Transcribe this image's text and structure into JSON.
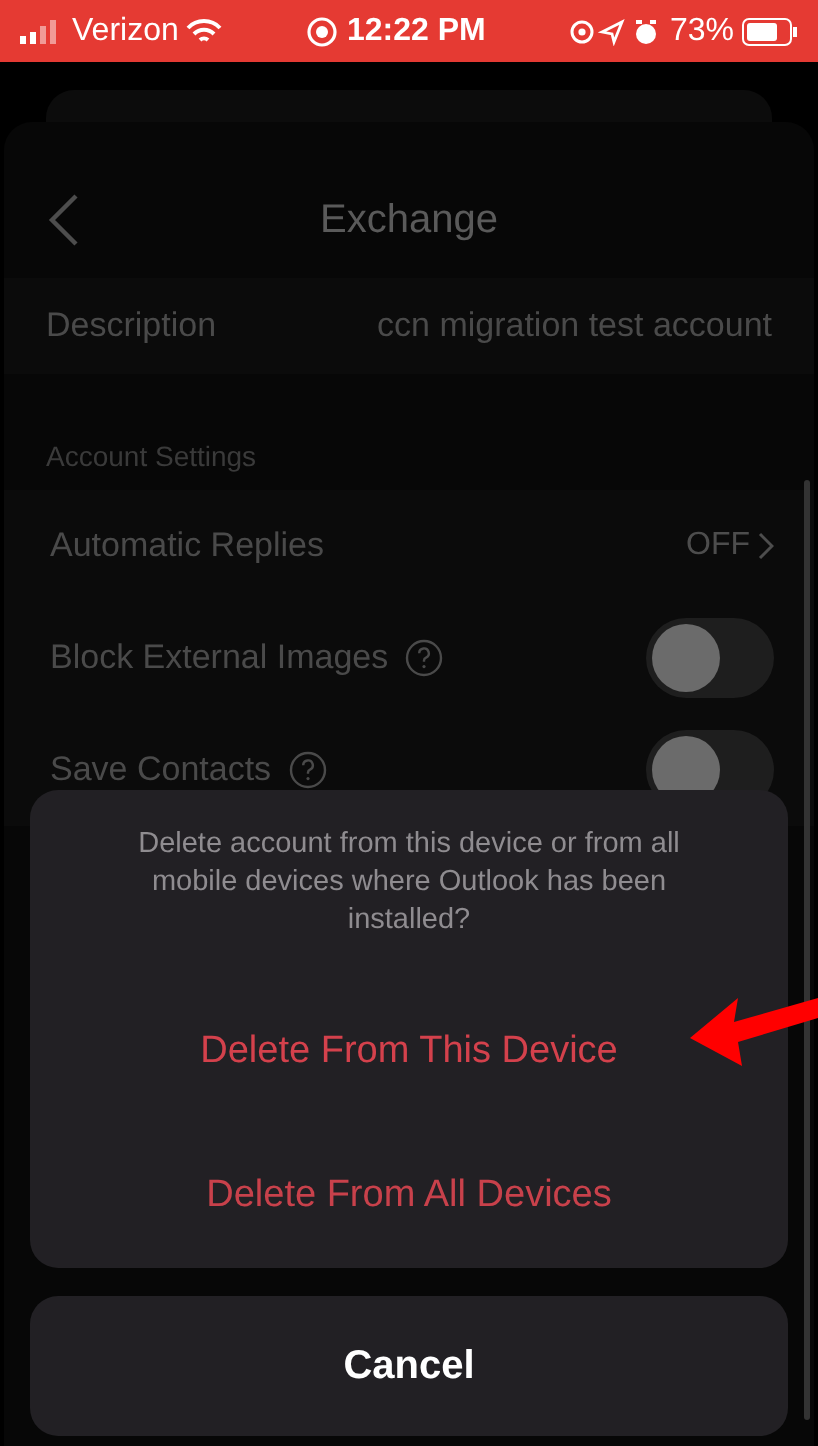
{
  "status_bar": {
    "carrier": "Verizon",
    "time": "12:22 PM",
    "battery": "73%"
  },
  "nav": {
    "title": "Exchange"
  },
  "description": {
    "label": "Description",
    "value": "ccn migration test account"
  },
  "section": {
    "title": "Account Settings"
  },
  "settings": [
    {
      "kind": "value",
      "label": "Automatic Replies",
      "value": "OFF",
      "help": false
    },
    {
      "kind": "toggle",
      "label": "Block External Images",
      "on": false,
      "help": true
    },
    {
      "kind": "toggle",
      "label": "Save Contacts",
      "on": false,
      "help": true
    }
  ],
  "action_sheet": {
    "message": "Delete account from this device or from all mobile devices where Outlook has been installed?",
    "actions": [
      {
        "label": "Delete From This Device",
        "highlighted": true
      },
      {
        "label": "Delete From All Devices",
        "highlighted": false
      }
    ],
    "cancel": "Cancel"
  }
}
